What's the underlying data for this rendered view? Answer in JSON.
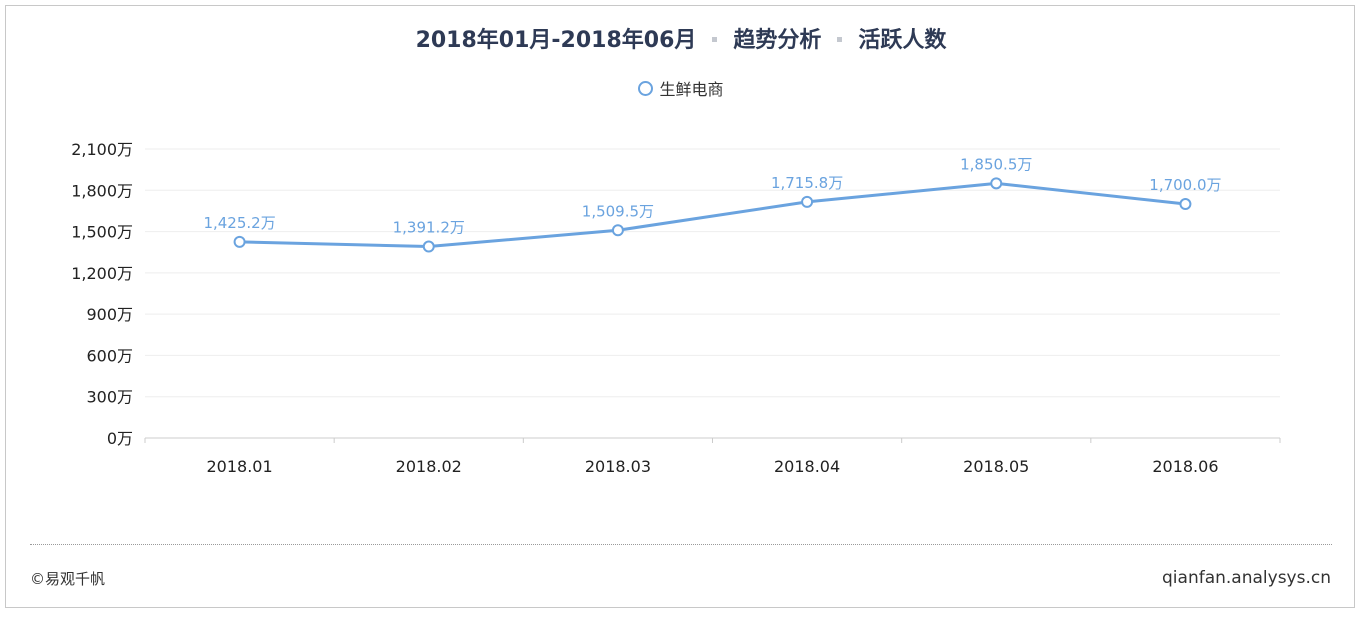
{
  "header": {
    "period": "2018年01月-2018年06月",
    "analysis": "趋势分析",
    "metric": "活跃人数"
  },
  "legend": {
    "label": "生鲜电商"
  },
  "footer": {
    "copyright": "©易观千帆",
    "site": "qianfan.analysys.cn"
  },
  "colors": {
    "series": "#6aa3df",
    "label": "#6aa3df",
    "grid": "#eeeeee",
    "axis": "#cccccc"
  },
  "chart_data": {
    "type": "line",
    "categories": [
      "2018.01",
      "2018.02",
      "2018.03",
      "2018.04",
      "2018.05",
      "2018.06"
    ],
    "series": [
      {
        "name": "生鲜电商",
        "values": [
          1425.2,
          1391.2,
          1509.5,
          1715.8,
          1850.5,
          1700.0
        ],
        "labels": [
          "1,425.2万",
          "1,391.2万",
          "1,509.5万",
          "1,715.8万",
          "1,850.5万",
          "1,700.0万"
        ]
      }
    ],
    "ylim": [
      0,
      2100
    ],
    "yticks": [
      0,
      300,
      600,
      900,
      1200,
      1500,
      1800,
      2100
    ],
    "ytick_labels": [
      "0万",
      "300万",
      "600万",
      "900万",
      "1,200万",
      "1,500万",
      "1,800万",
      "2,100万"
    ],
    "grid": true,
    "legend_position": "top-center"
  }
}
